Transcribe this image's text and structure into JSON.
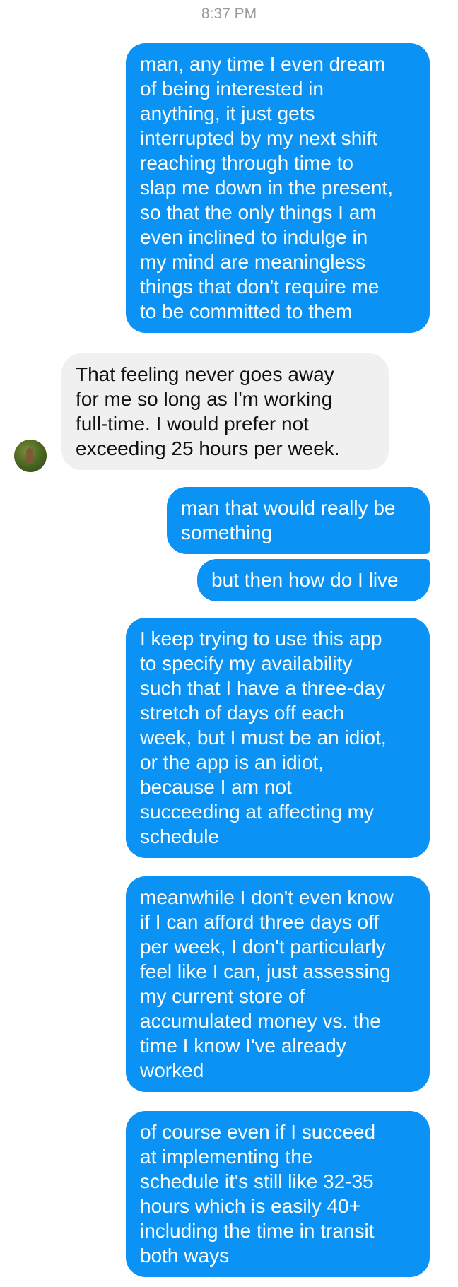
{
  "conversation": {
    "timestamp": "8:37 PM",
    "messages": [
      {
        "from": "me",
        "lines": [
          "man, any time I even dream",
          "of being interested in",
          "anything, it just gets",
          "interrupted by my next shift",
          "reaching through time to",
          "slap me down in the present,",
          "so that the only things I am",
          "even inclined to indulge in",
          "my mind are meaningless",
          "things that don't require me",
          "to be committed to them"
        ]
      },
      {
        "from": "them",
        "lines": [
          "That feeling never goes away",
          "for me so long as I'm working",
          "full-time. I would prefer not",
          "exceeding 25 hours per week."
        ]
      },
      {
        "from": "me",
        "lines": [
          "man that would really be",
          "something"
        ]
      },
      {
        "from": "me",
        "lines": [
          "but then how do I live"
        ]
      },
      {
        "from": "me",
        "lines": [
          "I keep trying to use this app",
          "to specify my availability",
          "such that I have a three-day",
          "stretch of days off each",
          "week, but I must be an idiot,",
          "or the app is an idiot,",
          "because I am not",
          "succeeding at affecting my",
          "schedule"
        ]
      },
      {
        "from": "me",
        "lines": [
          "meanwhile I don't even know",
          "if I can afford three days off",
          "per week, I don't particularly",
          "feel like I can, just assessing",
          "my current store of",
          "accumulated money vs. the",
          "time I know I've already",
          "worked"
        ]
      },
      {
        "from": "me",
        "lines": [
          "of course even if I succeed",
          "at implementing the",
          "schedule it's still like 32-35",
          "hours which is easily 40+",
          "including the time in transit",
          "both ways"
        ]
      }
    ]
  },
  "colors": {
    "outgoing_bubble": "#0a93f5",
    "incoming_bubble": "#f1f0f0",
    "timestamp_text": "#9a9a9a"
  }
}
